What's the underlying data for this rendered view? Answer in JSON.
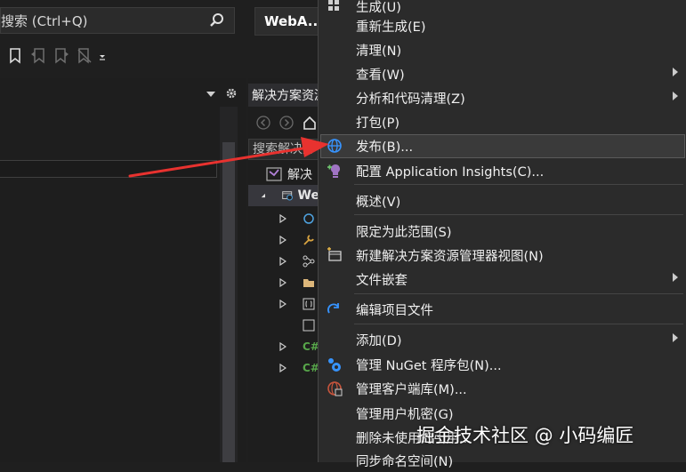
{
  "search": {
    "text": "搜索 (Ctrl+Q)"
  },
  "tab": {
    "label": "WebA..."
  },
  "solution_explorer": {
    "header": "解决方案资源",
    "search_placeholder": "搜索解决方",
    "solution_row": "解决",
    "project_row": "We"
  },
  "context_menu": {
    "items": [
      {
        "label": "生成(U)",
        "icon": "build-icon"
      },
      {
        "label": "重新生成(E)"
      },
      {
        "label": "清理(N)"
      },
      {
        "label": "查看(W)",
        "submenu": true
      },
      {
        "label": "分析和代码清理(Z)",
        "submenu": true
      },
      {
        "label": "打包(P)"
      },
      {
        "label": "发布(B)...",
        "icon": "publish-globe-icon",
        "highlighted": true
      },
      {
        "label": "配置 Application Insights(C)...",
        "icon": "application-insights-icon"
      },
      {
        "label": "概述(V)"
      },
      {
        "label": "限定为此范围(S)"
      },
      {
        "label": "新建解决方案资源管理器视图(N)",
        "icon": "new-view-icon"
      },
      {
        "label": "文件嵌套",
        "submenu": true
      },
      {
        "label": "编辑项目文件",
        "icon": "edit-project-icon"
      },
      {
        "label": "添加(D)",
        "submenu": true
      },
      {
        "label": "管理 NuGet 程序包(N)...",
        "icon": "nuget-icon"
      },
      {
        "label": "管理客户端库(M)...",
        "icon": "client-library-icon"
      },
      {
        "label": "管理用户机密(G)"
      },
      {
        "label": "删除未使用的引用..."
      },
      {
        "label": "同步命名空间(N)"
      }
    ]
  },
  "watermark": "掘金技术社区 @ 小码编匠",
  "colors": {
    "annotation_arrow": "#e8322f",
    "menu_bg": "#2b2b2b",
    "accent_blue": "#3794ff"
  }
}
